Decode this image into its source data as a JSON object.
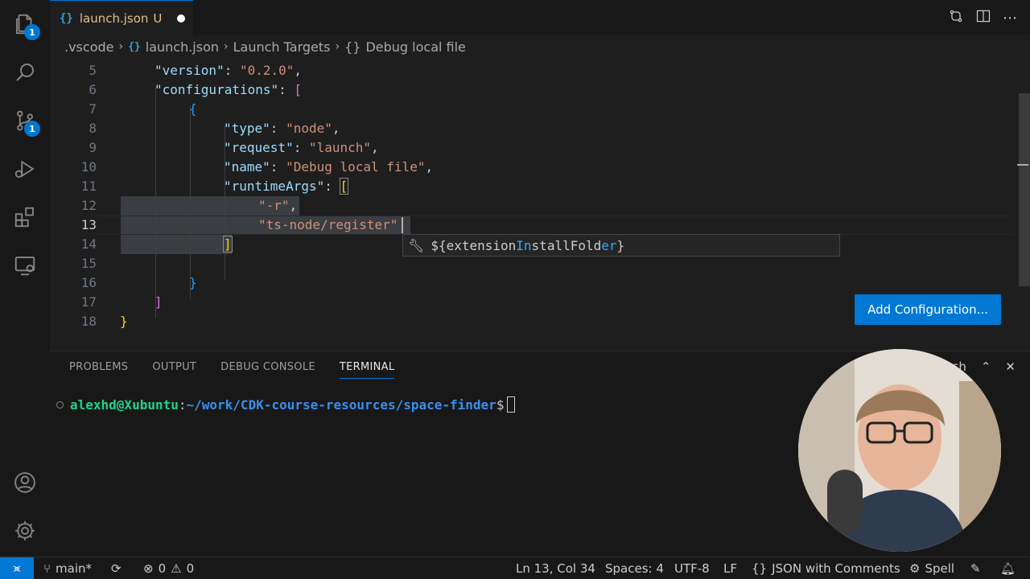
{
  "activity_bar": {
    "explorer_badge": "1",
    "scm_badge": "1"
  },
  "tab": {
    "label": "launch.json",
    "status": "U",
    "icon_text": "{}"
  },
  "breadcrumb": {
    "folder": ".vscode",
    "file": "launch.json",
    "section": "Launch Targets",
    "item": "Debug local file",
    "item_icon": "{}"
  },
  "editor": {
    "line_numbers": [
      "5",
      "6",
      "7",
      "8",
      "9",
      "10",
      "11",
      "12",
      "13",
      "14",
      "15",
      "16",
      "17",
      "18"
    ],
    "current_line": "13",
    "lines": {
      "l5_key": "\"version\"",
      "l5_val": "\"0.2.0\"",
      "l6_key": "\"configurations\"",
      "l7": "{",
      "l8_key": "\"type\"",
      "l8_val": "\"node\"",
      "l9_key": "\"request\"",
      "l9_val": "\"launch\"",
      "l10_key": "\"name\"",
      "l10_val": "\"Debug local file\"",
      "l11_key": "\"runtimeArgs\"",
      "l12_val": "\"-r\"",
      "l13_val": "\"ts-node/register\""
    },
    "suggestion": {
      "prefix": "${extension",
      "match1": "In",
      "mid": "st",
      "mid2": "allFold",
      "match2": "er",
      "suffix": "}"
    },
    "add_configuration_label": "Add Configuration..."
  },
  "panel": {
    "tabs": [
      "PROBLEMS",
      "OUTPUT",
      "DEBUG CONSOLE",
      "TERMINAL"
    ],
    "active_tab": "TERMINAL",
    "terminal_shell": "bash",
    "prompt_user": "alexhd@Xubuntu",
    "prompt_path": "~/work/CDK-course-resources/space-finder",
    "prompt_symbol": "$"
  },
  "status_bar": {
    "branch": "main*",
    "errors": "0",
    "warnings": "0",
    "cursor_position": "Ln 13, Col 34",
    "indentation": "Spaces: 4",
    "encoding": "UTF-8",
    "eol": "LF",
    "language": "JSON with Comments",
    "spell": "Spell"
  },
  "colors": {
    "accent": "#0078d4",
    "json_key": "#9cdcfe",
    "json_string": "#ce9178"
  }
}
